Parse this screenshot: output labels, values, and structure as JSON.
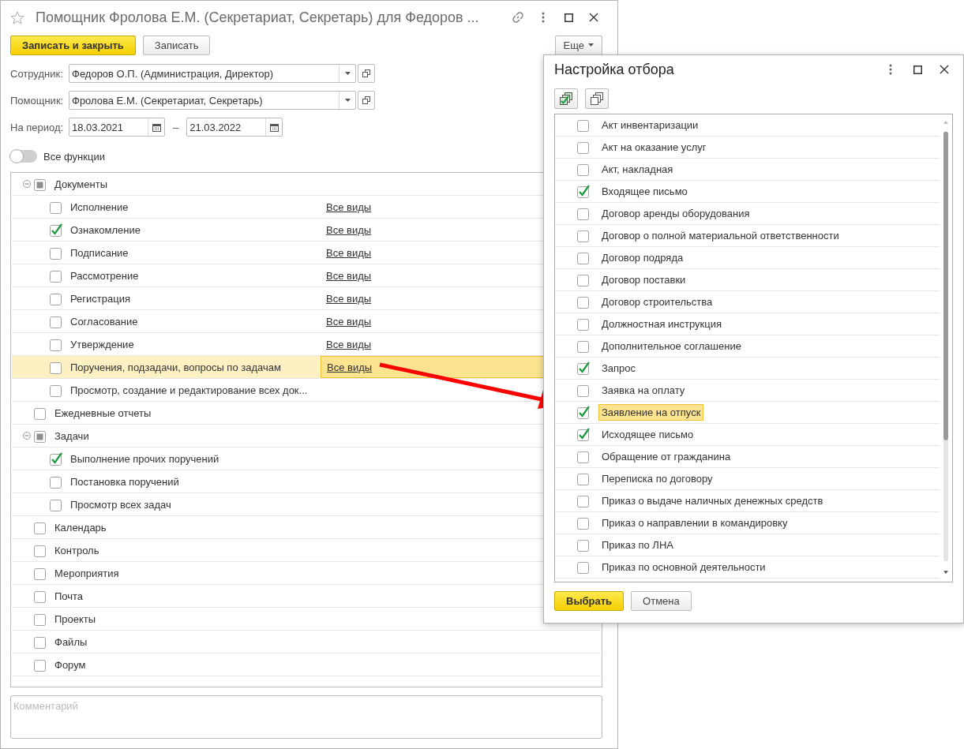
{
  "window": {
    "title": "Помощник Фролова Е.М. (Секретариат, Секретарь) для Федоров ..."
  },
  "toolbar": {
    "buttons": [
      {
        "label": "Записать и закрыть",
        "kind": "primary"
      },
      {
        "label": "Записать",
        "kind": "normal"
      }
    ],
    "more": "Еще"
  },
  "fields": [
    {
      "label": "Сотрудник:",
      "value": "Федоров О.П. (Администрация, Директор)"
    },
    {
      "label": "Помощник:",
      "value": "Фролова Е.М. (Секретариат, Секретарь)"
    }
  ],
  "period": {
    "label": "На период:",
    "from": "18.03.2021",
    "separator": "–",
    "to": "21.03.2022"
  },
  "switch": {
    "label": "Все функции",
    "on": false
  },
  "tree": [
    {
      "label": "Документы",
      "checked": false,
      "partial": true,
      "expanded": true,
      "selected": false,
      "children": [
        {
          "label": "Исполнение",
          "checked": false,
          "selected": false,
          "link": "Все виды"
        },
        {
          "label": "Ознакомление",
          "checked": true,
          "selected": false,
          "link": "Все виды"
        },
        {
          "label": "Подписание",
          "checked": false,
          "selected": false,
          "link": "Все виды"
        },
        {
          "label": "Рассмотрение",
          "checked": false,
          "selected": false,
          "link": "Все виды"
        },
        {
          "label": "Регистрация",
          "checked": false,
          "selected": false,
          "link": "Все виды"
        },
        {
          "label": "Согласование",
          "checked": false,
          "selected": false,
          "link": "Все виды"
        },
        {
          "label": "Утверждение",
          "checked": false,
          "selected": false,
          "link": "Все виды"
        },
        {
          "label": "Поручения, подзадачи, вопросы по задачам",
          "checked": false,
          "selected": true,
          "link": "Все виды"
        },
        {
          "label": "Просмотр, создание и редактирование всех док...",
          "checked": false,
          "selected": false
        }
      ]
    },
    {
      "label": "Ежедневные отчеты",
      "checked": false,
      "selected": false
    },
    {
      "label": "Задачи",
      "checked": false,
      "partial": true,
      "expanded": true,
      "selected": false,
      "children": [
        {
          "label": "Выполнение прочих поручений",
          "checked": true,
          "selected": false
        },
        {
          "label": "Постановка поручений",
          "checked": false,
          "selected": false
        },
        {
          "label": "Просмотр всех задач",
          "checked": false,
          "selected": false
        }
      ]
    },
    {
      "label": "Календарь",
      "checked": false,
      "selected": false
    },
    {
      "label": "Контроль",
      "checked": false,
      "selected": false
    },
    {
      "label": "Мероприятия",
      "checked": false,
      "selected": false
    },
    {
      "label": "Почта",
      "checked": false,
      "selected": false
    },
    {
      "label": "Проекты",
      "checked": false,
      "selected": false
    },
    {
      "label": "Файлы",
      "checked": false,
      "selected": false
    },
    {
      "label": "Форум",
      "checked": false,
      "selected": false
    }
  ],
  "comment": {
    "placeholder": "Комментарий"
  },
  "dialog": {
    "title": "Настройка отбора",
    "items": [
      {
        "label": "Акт инвентаризации",
        "checked": false,
        "selected": false
      },
      {
        "label": "Акт на оказание услуг",
        "checked": false,
        "selected": false
      },
      {
        "label": "Акт, накладная",
        "checked": false,
        "selected": false
      },
      {
        "label": "Входящее письмо",
        "checked": true,
        "selected": false
      },
      {
        "label": "Договор аренды оборудования",
        "checked": false,
        "selected": false
      },
      {
        "label": "Договор о полной материальной ответственности",
        "checked": false,
        "selected": false
      },
      {
        "label": "Договор подряда",
        "checked": false,
        "selected": false
      },
      {
        "label": "Договор поставки",
        "checked": false,
        "selected": false
      },
      {
        "label": "Договор строительства",
        "checked": false,
        "selected": false
      },
      {
        "label": "Должностная инструкция",
        "checked": false,
        "selected": false
      },
      {
        "label": "Дополнительное соглашение",
        "checked": false,
        "selected": false
      },
      {
        "label": "Запрос",
        "checked": true,
        "selected": false
      },
      {
        "label": "Заявка на оплату",
        "checked": false,
        "selected": false
      },
      {
        "label": "Заявление на отпуск",
        "checked": true,
        "selected": true
      },
      {
        "label": "Исходящее письмо",
        "checked": true,
        "selected": false
      },
      {
        "label": "Обращение от гражданина",
        "checked": false,
        "selected": false
      },
      {
        "label": "Переписка по договору",
        "checked": false,
        "selected": false
      },
      {
        "label": "Приказ о выдаче наличных денежных средств",
        "checked": false,
        "selected": false
      },
      {
        "label": "Приказ о направлении в командировку",
        "checked": false,
        "selected": false
      },
      {
        "label": "Приказ по ЛНА",
        "checked": false,
        "selected": false
      },
      {
        "label": "Приказ по основной деятельности",
        "checked": false,
        "selected": false
      }
    ],
    "buttons": [
      {
        "label": "Выбрать",
        "kind": "primary"
      },
      {
        "label": "Отмена",
        "kind": "normal"
      }
    ]
  }
}
